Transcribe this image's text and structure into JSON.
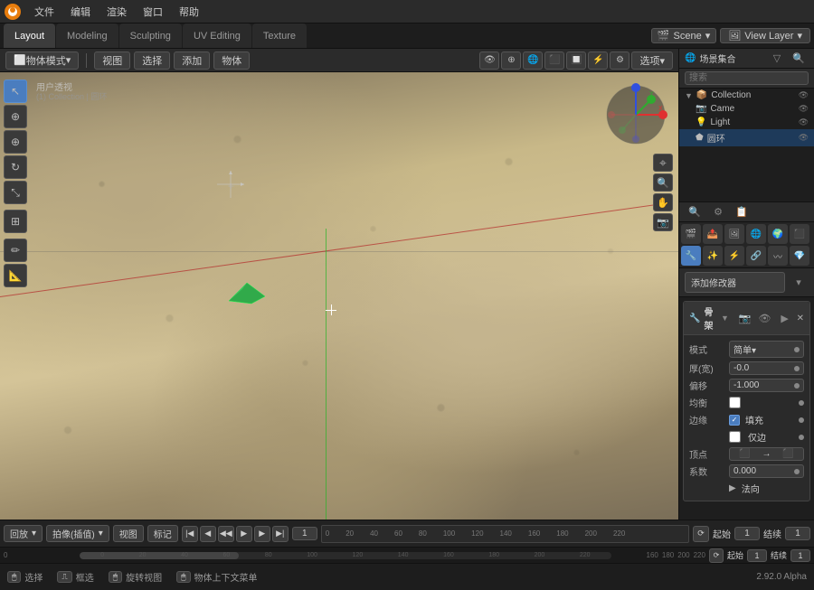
{
  "app": {
    "title": "Blender",
    "logo": "🔵"
  },
  "menubar": {
    "items": [
      "文件",
      "编辑",
      "渲染",
      "窗口",
      "帮助"
    ]
  },
  "workspace_tabs": {
    "tabs": [
      "Layout",
      "Modeling",
      "Sculpting",
      "UV Editing",
      "Texture"
    ],
    "active": "Layout"
  },
  "scene_selector": {
    "label": "Scene",
    "value": "Scene"
  },
  "viewlayer": {
    "label": "View Layer",
    "value": "View Layer"
  },
  "toolbar": {
    "mode": "物体模式",
    "view": "视图",
    "select": "选择",
    "add": "添加",
    "object": "物体"
  },
  "viewport": {
    "view_label": "用户透视",
    "collection_label": "(1) Collection | 圆环",
    "options_btn": "选项▾",
    "header_icons": [
      "⬛",
      "🔲",
      "🔷",
      "⊕",
      "👁",
      "🔵",
      "🌐"
    ]
  },
  "outliner": {
    "title": "场景集合",
    "search_placeholder": "搜索",
    "items": [
      {
        "label": "Collection",
        "icon": "▸",
        "level": 0,
        "type": "collection",
        "has_expand": true,
        "visible": true
      },
      {
        "label": "Came",
        "icon": "📷",
        "level": 1,
        "type": "camera",
        "visible": true
      },
      {
        "label": "Light",
        "icon": "💡",
        "level": 1,
        "type": "light",
        "visible": true
      },
      {
        "label": "圆环",
        "icon": "⬟",
        "level": 1,
        "type": "mesh",
        "visible": true,
        "selected": true
      }
    ]
  },
  "properties": {
    "tabs": [
      "🔧",
      "🌐",
      "⚙",
      "👁",
      "🔲",
      "⬛",
      "💎",
      "🖌",
      "🔗",
      "〰"
    ],
    "active_tab": "🔧",
    "add_modifier_label": "添加修改器",
    "modifier": {
      "name": "骨架",
      "icon": "🔧",
      "mode_label": "模式",
      "mode_value": "简单▾",
      "width_label": "厚(宽)",
      "width_value": "-0.0",
      "offset_label": "偏移",
      "offset_value": "-1.000",
      "balance_label": "均衡",
      "balance_checked": false,
      "edge_label": "边缘",
      "fill_label": "填充",
      "fill_checked": true,
      "edge_only_label": "仅边",
      "vertex_label": "顶点",
      "count_label": "系数",
      "count_value": "0.000",
      "normal_label": "法向"
    }
  },
  "timeline": {
    "playback_label": "回放",
    "capture_label": "拍像(插值)",
    "view_label": "视图",
    "markers_label": "标记",
    "frame_current": "1",
    "frame_start": "起始",
    "frame_start_val": "1",
    "frame_end": "结续",
    "frame_end_val": "1",
    "start_frame": "起始",
    "start_val": "1",
    "end_frame": "结续",
    "end_val": "1",
    "ruler_marks": [
      "0",
      "20",
      "40",
      "60",
      "80",
      "100",
      "120",
      "140",
      "160",
      "180",
      "200",
      "220",
      "160",
      "180",
      "200",
      "220"
    ]
  },
  "statusbar": {
    "select_label": "选择",
    "box_select_label": "框选",
    "rotate_label": "旋转视图",
    "context_menu_label": "物体上下文菜单",
    "version": "2.92.0 Alpha"
  }
}
